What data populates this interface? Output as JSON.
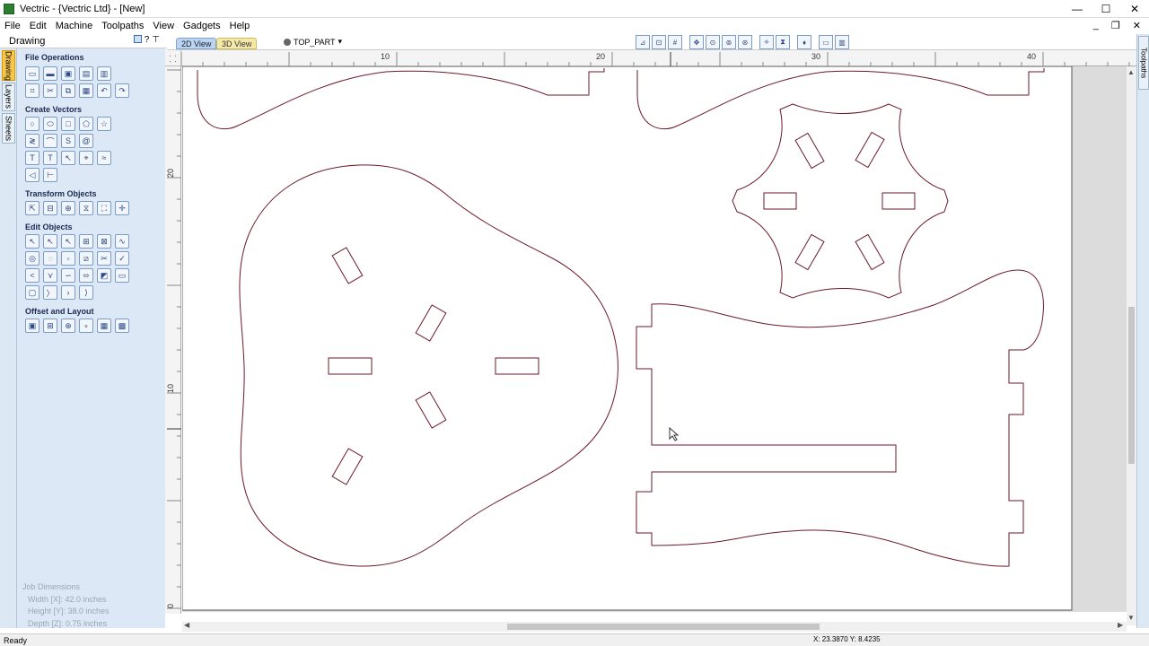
{
  "window": {
    "title": "Vectric - {Vectric Ltd} - [New]",
    "minimize": "—",
    "maximize": "☐",
    "close": "✕"
  },
  "menu": {
    "items": [
      "File",
      "Edit",
      "Machine",
      "Toolpaths",
      "View",
      "Gadgets",
      "Help"
    ],
    "mdi_min": "_",
    "mdi_restore": "❐",
    "mdi_close": "✕"
  },
  "panel": {
    "title": "Drawing",
    "help": "?",
    "pin": "⊤",
    "left_tabs": [
      "Drawing",
      "Layers",
      "Sheets"
    ],
    "sections": {
      "file_operations": "File Operations",
      "create_vectors": "Create Vectors",
      "transform_objects": "Transform Objects",
      "edit_objects": "Edit Objects",
      "offset_layout": "Offset and Layout"
    }
  },
  "job_dimensions": {
    "title": "Job Dimensions",
    "width": "Width  [X]: 42.0 inches",
    "height": "Height [Y]: 38.0 inches",
    "depth": "Depth  [Z]: 0.75 inches"
  },
  "view_tabs": {
    "view_2d": "2D View",
    "view_3d": "3D View"
  },
  "layer": {
    "name": "TOP_PART",
    "dropdown": "▾"
  },
  "right_tab": "Toolpaths",
  "rulers": {
    "h_labels": [
      "10",
      "20",
      "30",
      "40"
    ],
    "v_labels": [
      "20",
      "10",
      "0"
    ]
  },
  "status": {
    "text": "Ready",
    "coords": "X: 23.3870 Y:  8.4235"
  },
  "colors": {
    "vector": "#6b1a2a",
    "job_bg": "#ffffff",
    "outside": "#dcdcdc",
    "panel": "#dce8f5"
  }
}
